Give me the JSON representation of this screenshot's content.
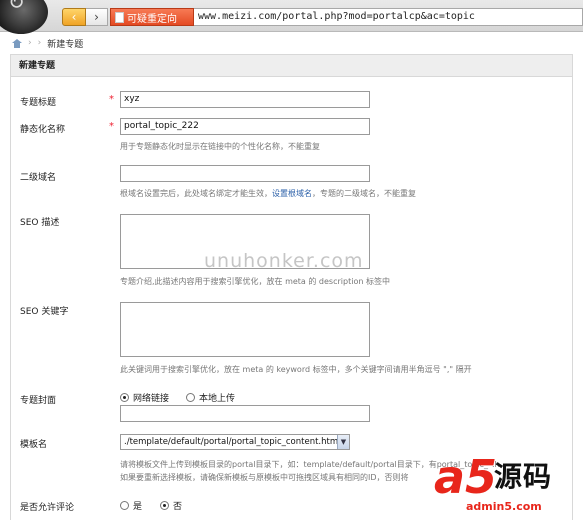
{
  "browser": {
    "badge_text": "可疑重定向",
    "address": "www.meizi.com/portal.php?mod=portalcp&ac=topic",
    "back_glyph": "‹",
    "forward_glyph": "›"
  },
  "breadcrumb": {
    "separator": "›",
    "current": "新建专题"
  },
  "panel": {
    "title": "新建专题"
  },
  "form": {
    "required_mark": "*",
    "title_label": "专题标题",
    "title_value": "xyz",
    "static_label": "静态化名称",
    "static_value": "portal_topic_222",
    "static_tip": "用于专题静态化时显示在链接中的个性化名称，不能重复",
    "domain_label": "二级域名",
    "domain_value": "",
    "domain_tip_before": "根域名设置完后，此处域名绑定才能生效，",
    "domain_tip_link": "设置根域名",
    "domain_tip_after": "，专题的二级域名，不能重复",
    "seo_desc_label": "SEO 描述",
    "seo_desc_tip": "专题介绍,此描述内容用于搜索引擎优化，放在 meta 的 description 标签中",
    "seo_kw_label": "SEO 关键字",
    "seo_kw_tip": "此关键词用于搜索引擎优化，放在 meta 的 keyword 标签中，多个关键字间请用半角逗号 \",\" 隔开",
    "cover_label": "专题封面",
    "cover_opt1": "网络链接",
    "cover_opt2": "本地上传",
    "template_label": "模板名",
    "template_value": "./template/default/portal/portal_topic_content.htm",
    "template_tip1": "请将模板文件上传到模板目录的portal目录下，如：template/default/portal目录下，",
    "template_tip1_tail": "有portal_topic_*.h",
    "template_tip2": "如果要重新选择模板，请确保新模板与原模板中可拖拽区域具有相同的ID，否则将",
    "comment_label": "是否允许评论",
    "comment_yes": "是",
    "comment_no": "否"
  },
  "watermark": "unuhonker.com",
  "logo": {
    "letter": "a5",
    "cn": "源码",
    "url": "admin5.com"
  }
}
